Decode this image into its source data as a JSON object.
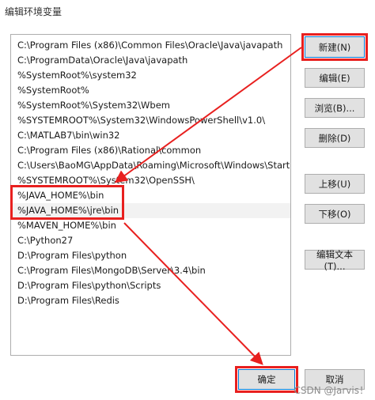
{
  "window": {
    "title": "编辑环境变量"
  },
  "paths": [
    "C:\\Program Files (x86)\\Common Files\\Oracle\\Java\\javapath",
    "C:\\ProgramData\\Oracle\\Java\\javapath",
    "%SystemRoot%\\system32",
    "%SystemRoot%",
    "%SystemRoot%\\System32\\Wbem",
    "%SYSTEMROOT%\\System32\\WindowsPowerShell\\v1.0\\",
    "C:\\MATLAB7\\bin\\win32",
    "C:\\Program Files (x86)\\Rational\\common",
    "C:\\Users\\BaoMG\\AppData\\Roaming\\Microsoft\\Windows\\Start ...",
    "%SYSTEMROOT%\\System32\\OpenSSH\\",
    "%JAVA_HOME%\\bin",
    "%JAVA_HOME%\\jre\\bin",
    "%MAVEN_HOME%\\bin",
    "C:\\Python27",
    "D:\\Program Files\\python",
    "C:\\Program Files\\MongoDB\\Server\\3.4\\bin",
    "D:\\Program Files\\python\\Scripts",
    "D:\\Program Files\\Redis"
  ],
  "buttons": {
    "new": "新建(N)",
    "edit": "编辑(E)",
    "browse": "浏览(B)...",
    "delete": "删除(D)",
    "move_up": "上移(U)",
    "move_down": "下移(O)",
    "edit_text": "编辑文本(T)...",
    "ok": "确定",
    "cancel": "取消"
  },
  "watermark": "CSDN @Jarvis！",
  "colors": {
    "highlight": "#e8201f",
    "focus_border": "#0078d7",
    "selected_row": "#f2f2f2"
  }
}
